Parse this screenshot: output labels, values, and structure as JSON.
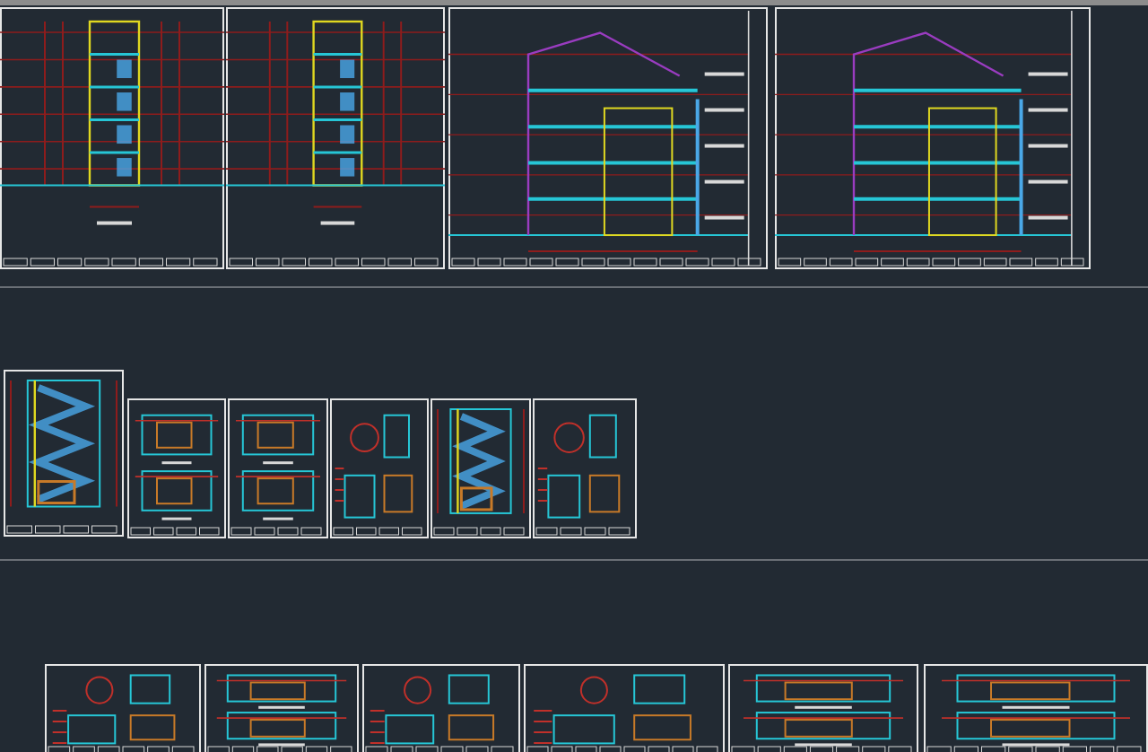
{
  "rows": [
    {
      "sheets": [
        {
          "kind": "elevation"
        },
        {
          "kind": "elevation"
        },
        {
          "kind": "section"
        },
        {
          "kind": "section"
        }
      ]
    },
    {
      "sheets": [
        {
          "kind": "stair"
        },
        {
          "kind": "plans"
        },
        {
          "kind": "plans"
        },
        {
          "kind": "detail"
        },
        {
          "kind": "stair"
        },
        {
          "kind": "detail"
        }
      ]
    },
    {
      "sheets": [
        {
          "kind": "detail"
        },
        {
          "kind": "plans"
        },
        {
          "kind": "detail"
        },
        {
          "kind": "detail"
        },
        {
          "kind": "plans"
        },
        {
          "kind": "plans"
        }
      ]
    }
  ]
}
